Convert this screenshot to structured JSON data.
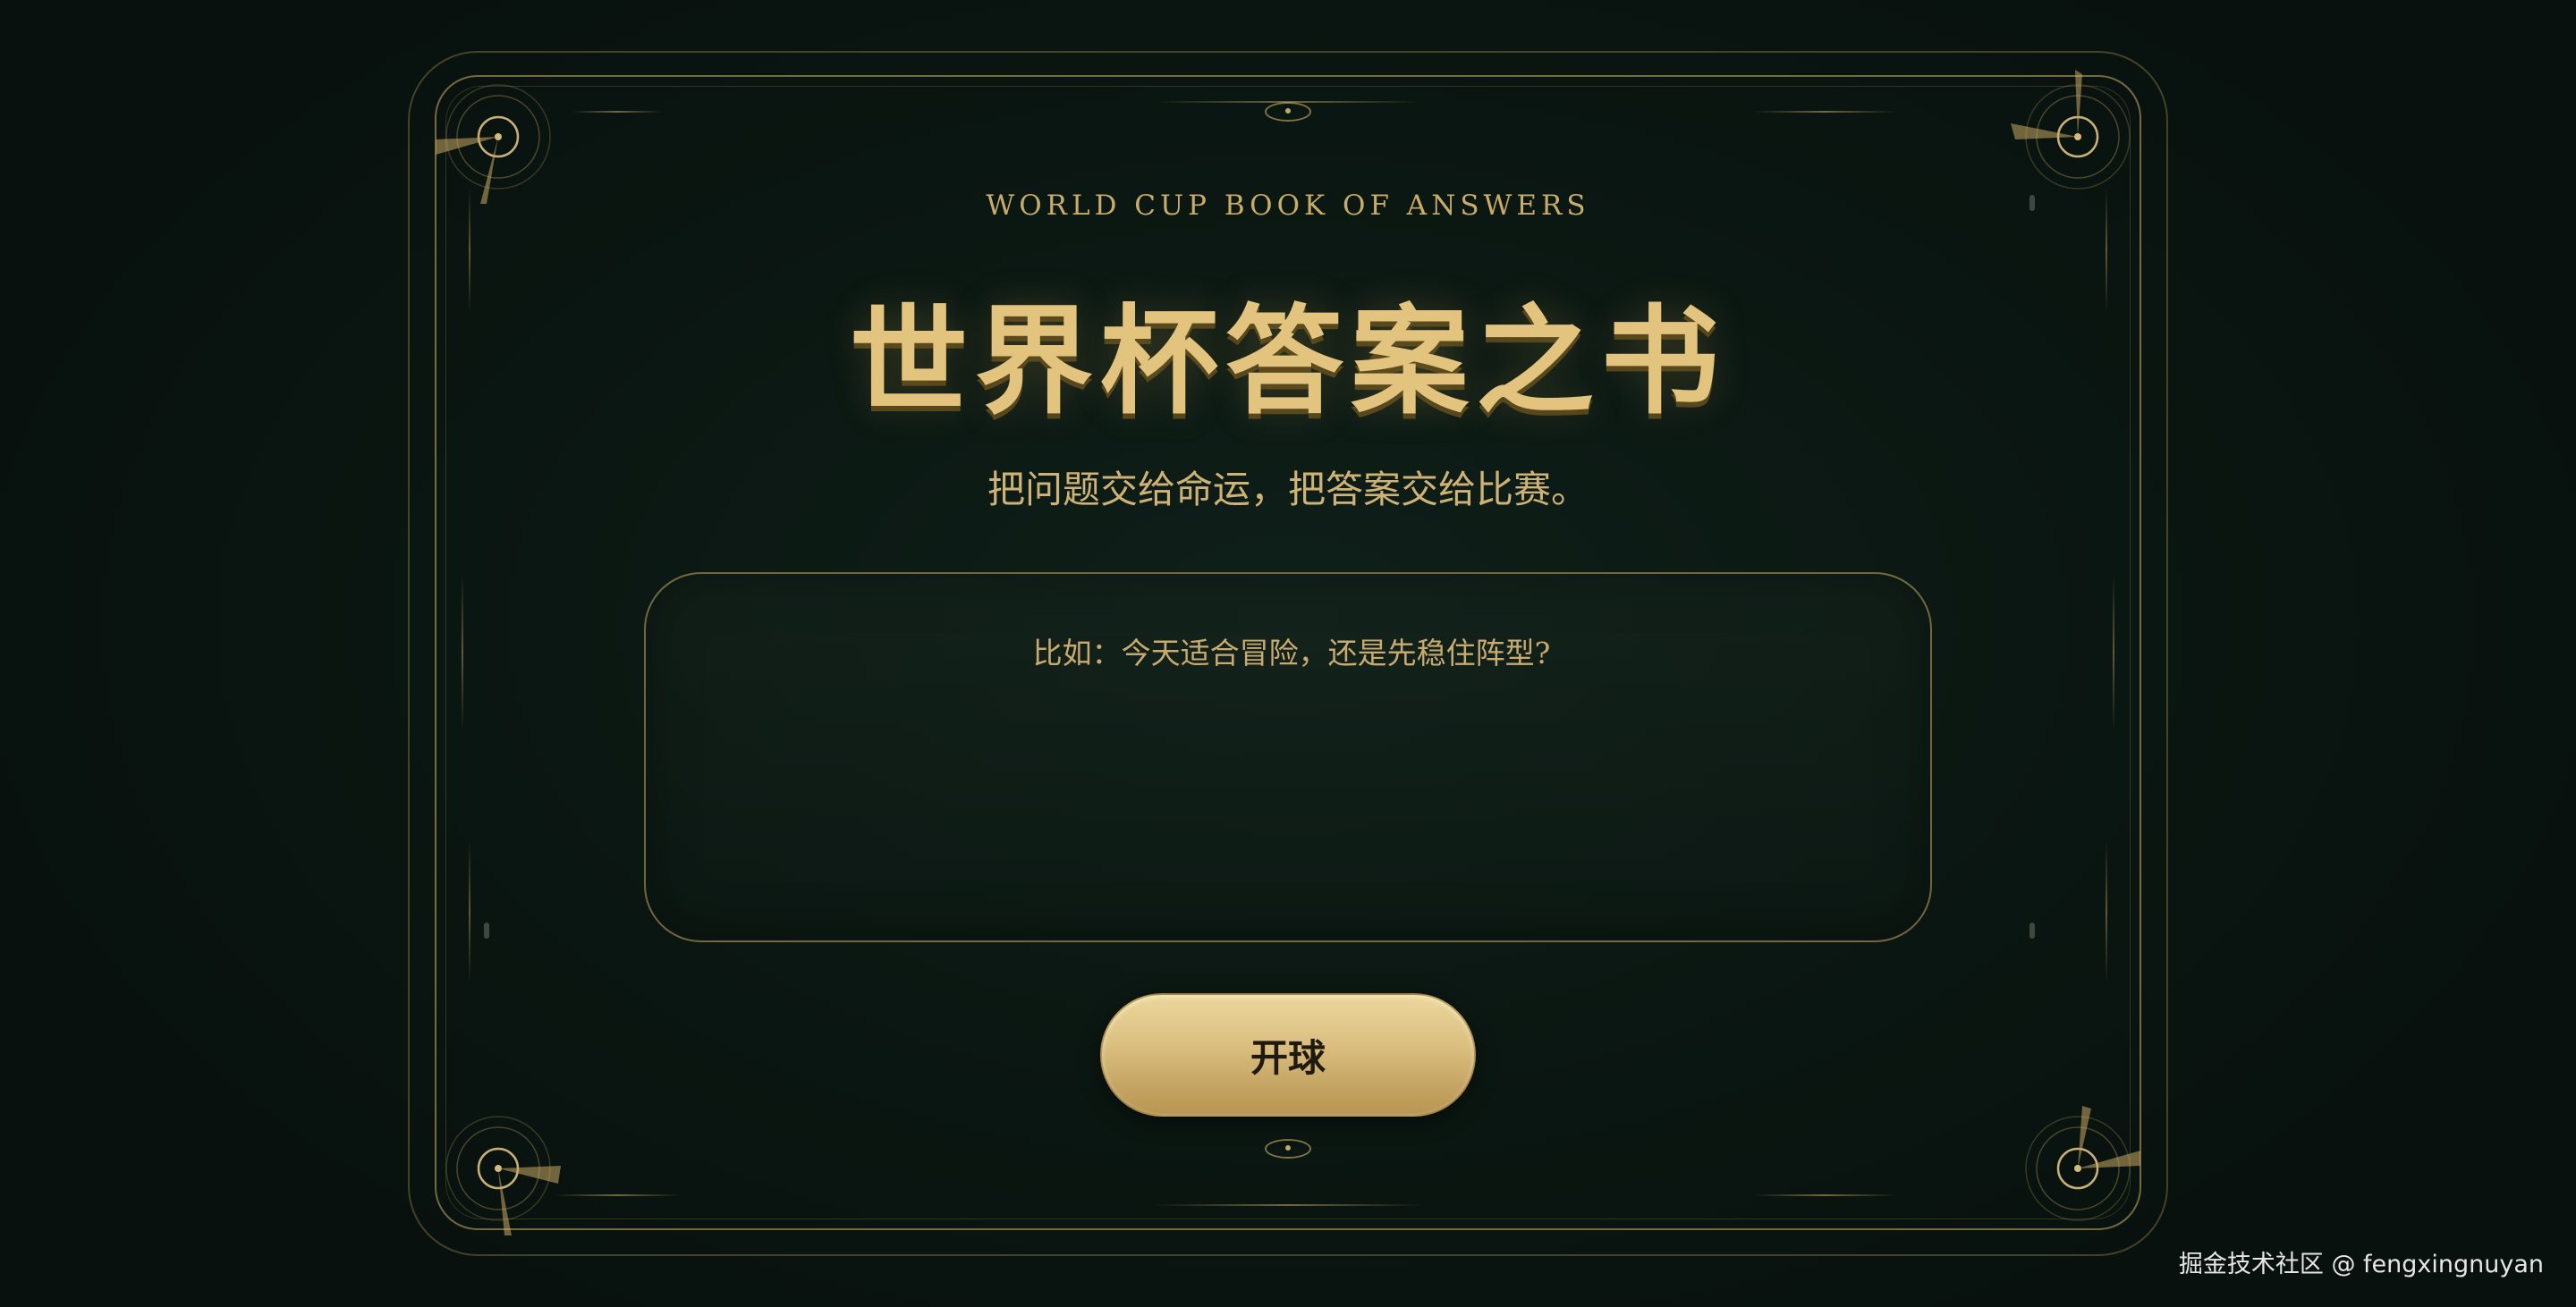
{
  "header": {
    "eyebrow": "WORLD CUP BOOK OF ANSWERS",
    "title": "世界杯答案之书",
    "tagline": "把问题交给命运，把答案交给比赛。"
  },
  "question": {
    "placeholder": "比如：今天适合冒险，还是先稳住阵型?",
    "value": ""
  },
  "actions": {
    "kickoff_label": "开球"
  },
  "footer": {
    "watermark": "掘金技术社区 @ fengxingnuyan"
  },
  "theme": {
    "background": "#0a1411",
    "gold": "#e3c47f",
    "gold_muted": "#c9ab6a"
  },
  "icons": {
    "corners": [
      "compass-ornament-icon",
      "compass-ornament-icon",
      "compass-ornament-icon",
      "compass-ornament-icon"
    ],
    "medallions": [
      "medallion-icon",
      "medallion-icon"
    ]
  }
}
